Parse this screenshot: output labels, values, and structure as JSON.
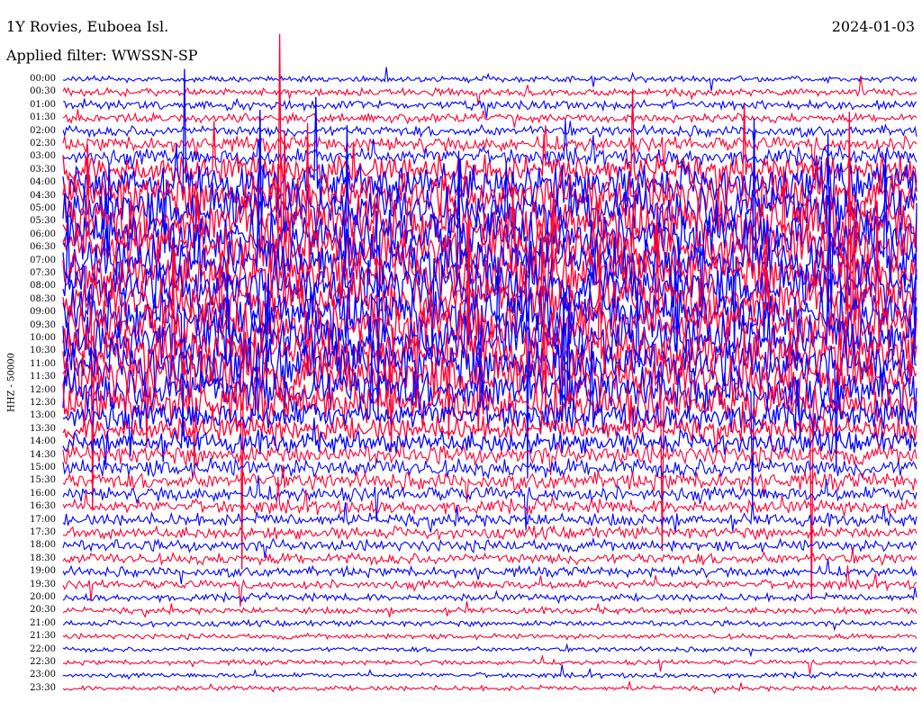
{
  "header": {
    "station": "1Y Rovies, Euboea Isl.",
    "filter": "Applied filter: WWSSN-SP",
    "date": "2024-01-03",
    "channel_label": "HHZ - 50000"
  },
  "chart_data": {
    "type": "helicorder",
    "row_labels": [
      "00:00",
      "00:30",
      "01:00",
      "01:30",
      "02:00",
      "02:30",
      "03:00",
      "03:30",
      "04:00",
      "04:30",
      "05:00",
      "05:30",
      "06:00",
      "06:30",
      "07:00",
      "07:30",
      "08:00",
      "08:30",
      "09:00",
      "09:30",
      "10:00",
      "10:30",
      "11:00",
      "11:30",
      "12:00",
      "12:30",
      "13:00",
      "13:30",
      "14:00",
      "14:30",
      "15:00",
      "15:30",
      "16:00",
      "16:30",
      "17:00",
      "17:30",
      "18:00",
      "18:30",
      "19:00",
      "19:30",
      "20:00",
      "20:30",
      "21:00",
      "21:30",
      "22:00",
      "22:30",
      "23:00",
      "23:30"
    ],
    "trace_colors": [
      "#0000ff",
      "#ff0033"
    ],
    "relative_amplitude_by_row": [
      1.2,
      1.5,
      1.8,
      1.8,
      2.2,
      3.0,
      3.5,
      6,
      8,
      9,
      10,
      10,
      10,
      10,
      10,
      10,
      10,
      10,
      10,
      10,
      10,
      10,
      10,
      10,
      9,
      8,
      6,
      5,
      4.5,
      4,
      3.8,
      3.5,
      3.0,
      2.8,
      2.6,
      2.5,
      2.4,
      2.3,
      2.0,
      1.8,
      1.5,
      1.3,
      1.2,
      1.1,
      1.0,
      1.0,
      1.0,
      1.0
    ]
  }
}
